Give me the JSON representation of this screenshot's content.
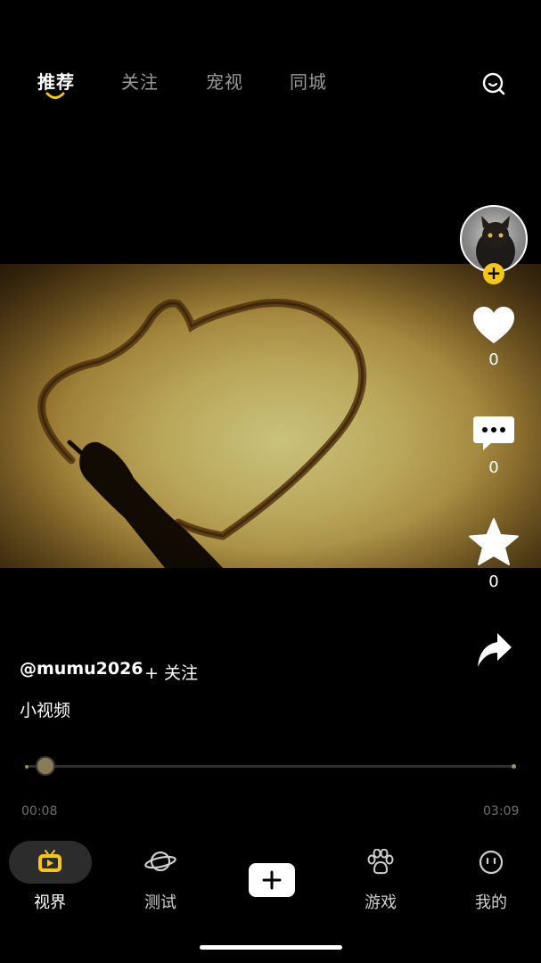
{
  "tabs": [
    {
      "label": "推荐",
      "active": true
    },
    {
      "label": "关注",
      "active": false
    },
    {
      "label": "宠视",
      "active": false
    },
    {
      "label": "同城",
      "active": false
    }
  ],
  "actions": {
    "like_count": "0",
    "comment_count": "0",
    "favorite_count": "0"
  },
  "author": {
    "username": "@mumu2026",
    "follow_label": "+ 关注",
    "follow_badge": "+"
  },
  "video": {
    "caption": "小视频",
    "current_time": "00:08",
    "total_time": "03:09",
    "progress": 0.042
  },
  "bottom_nav": [
    {
      "label": "视界",
      "icon": "tv-icon",
      "active": true
    },
    {
      "label": "测试",
      "icon": "planet-icon",
      "active": false
    },
    {
      "label": "",
      "icon": "plus-icon",
      "active": false
    },
    {
      "label": "游戏",
      "icon": "paw-icon",
      "active": false
    },
    {
      "label": "我的",
      "icon": "face-icon",
      "active": false
    }
  ],
  "colors": {
    "accent": "#f5c518",
    "background": "#000000",
    "inactive_text": "#9a9a9a"
  }
}
